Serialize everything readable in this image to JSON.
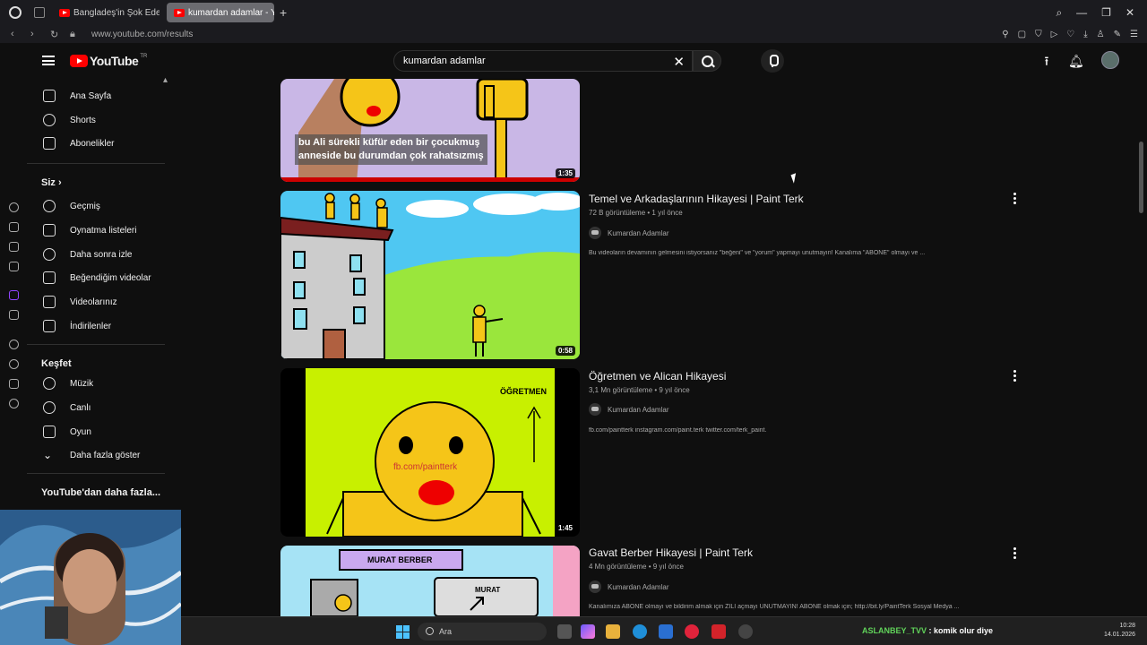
{
  "browser": {
    "tabs": [
      {
        "label": "Bangladeş'in Şok Eden Ye"
      },
      {
        "label": "kumardan adamlar - YouT"
      }
    ],
    "url": "www.youtube.com/results"
  },
  "header": {
    "logo_text": "YouTube",
    "logo_region": "TR",
    "search_value": "kumardan adamlar"
  },
  "sidebar": {
    "main_items": [
      {
        "label": "Ana Sayfa",
        "icon": "home-icon"
      },
      {
        "label": "Shorts",
        "icon": "shorts-icon"
      },
      {
        "label": "Abonelikler",
        "icon": "subscriptions-icon"
      }
    ],
    "you_heading": "Siz",
    "you_items": [
      {
        "label": "Geçmiş",
        "icon": "history-icon"
      },
      {
        "label": "Oynatma listeleri",
        "icon": "playlist-icon"
      },
      {
        "label": "Daha sonra izle",
        "icon": "watch-later-icon"
      },
      {
        "label": "Beğendiğim videolar",
        "icon": "like-icon"
      },
      {
        "label": "Videolarınız",
        "icon": "your-videos-icon"
      },
      {
        "label": "İndirilenler",
        "icon": "download-icon"
      }
    ],
    "explore_heading": "Keşfet",
    "explore_items": [
      {
        "label": "Müzik",
        "icon": "music-icon"
      },
      {
        "label": "Canlı",
        "icon": "live-icon"
      },
      {
        "label": "Oyun",
        "icon": "gaming-icon"
      },
      {
        "label": "Daha fazla göster",
        "icon": "chevron-down-icon"
      }
    ],
    "more_heading": "YouTube'dan daha fazla..."
  },
  "results": [
    {
      "title": "",
      "caption_line1": "bu Ali sürekli küfür eden bir çocukmuş",
      "caption_line2": "anneside bu durumdan çok rahatsızmış",
      "duration": "1:35"
    },
    {
      "title": "Temel ve Arkadaşlarının Hikayesi | Paint Terk",
      "meta": "72 B görüntüleme • 1 yıl önce",
      "channel": "Kumardan Adamlar",
      "description": "Bu videoların devamının gelmesini istiyorsanız \"beğeni\" ve \"yorum\" yapmayı unutmayın! Kanalıma \"ABONE\" olmayı ve ...",
      "duration": "0:58"
    },
    {
      "title": "Öğretmen ve Alican Hikayesi",
      "meta": "3,1 Mn görüntüleme • 9 yıl önce",
      "channel": "Kumardan Adamlar",
      "description": "fb.com/paintterk instagram.com/paint.terk twitter.com/terk_paint.",
      "duration": "1:45",
      "thumb_text_teacher": "ÖĞRETMEN",
      "thumb_text_fb": "fb.com/paintterk"
    },
    {
      "title": "Gavat Berber Hikayesi | Paint Terk",
      "meta": "4 Mn görüntüleme • 9 yıl önce",
      "channel": "Kumardan Adamlar",
      "description": "Kanalımıza ABONE olmayı ve bildirim almak için ZİLİ açmayı UNUTMAYIN! ABONE olmak için; http://bit.ly/PaintTerk Sosyal Medya ...",
      "thumb_text_sign": "MURAT BERBER",
      "thumb_text_name": "MURAT"
    }
  ],
  "taskbar": {
    "search_placeholder": "Ara",
    "chat_user": "ASLANBEY_TVV",
    "chat_text": ": komik olur diye",
    "time": "10:28",
    "date": "14.01.2026"
  },
  "colors": {
    "background": "#0f0f0f",
    "youtube_red": "#ff0000",
    "thumb_yellow": "#f5c518",
    "thumb_green": "#c8f000"
  }
}
